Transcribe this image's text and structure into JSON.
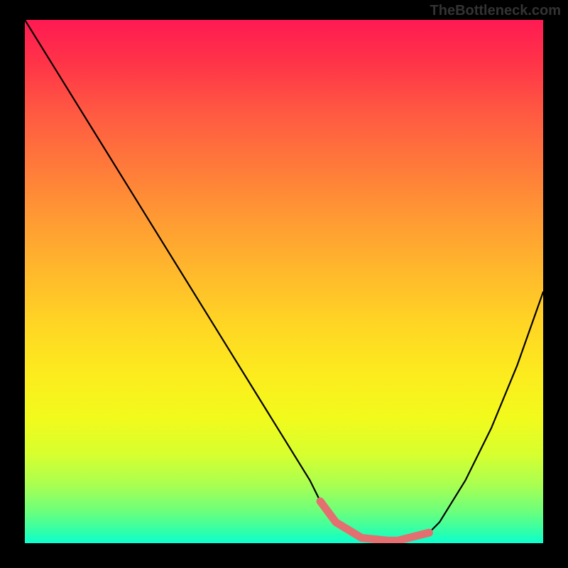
{
  "attribution": "TheBottleneck.com",
  "chart_data": {
    "type": "line",
    "title": "",
    "xlabel": "",
    "ylabel": "",
    "xlim": [
      0,
      100
    ],
    "ylim": [
      0,
      100
    ],
    "series": [
      {
        "name": "bottleneck-curve",
        "x": [
          0,
          5,
          10,
          15,
          20,
          25,
          30,
          35,
          40,
          45,
          50,
          55,
          57,
          60,
          65,
          70,
          72,
          78,
          80,
          85,
          90,
          95,
          100
        ],
        "y": [
          100,
          92,
          84,
          76,
          68,
          60,
          52,
          44,
          36,
          28,
          20,
          12,
          8,
          4,
          1,
          0.5,
          0.5,
          2,
          4,
          12,
          22,
          34,
          48
        ],
        "color": "#000000"
      },
      {
        "name": "optimal-zone-marker",
        "x": [
          57,
          60,
          65,
          70,
          72,
          78
        ],
        "y": [
          8,
          4,
          1,
          0.5,
          0.5,
          2
        ],
        "color": "#e36f70"
      }
    ]
  }
}
